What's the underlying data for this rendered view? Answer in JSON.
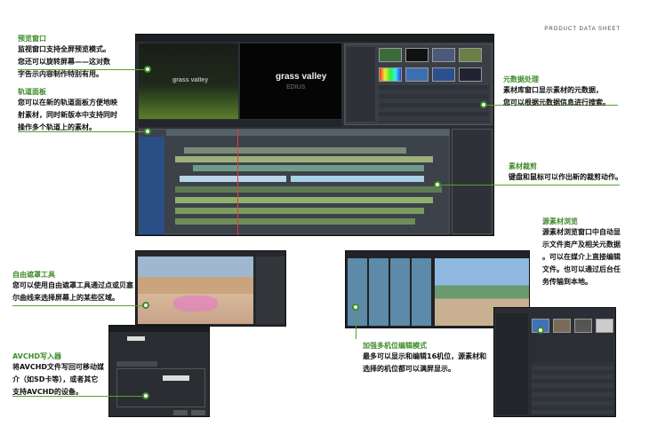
{
  "header": {
    "label": "PRODUCT DATA SHEET"
  },
  "sections": {
    "preview": {
      "title": "预览窗口",
      "lines": [
        "监视窗口支持全屏预览模式。",
        "您还可以旋转屏幕——这对数",
        "字告示内容制作特别有用。"
      ]
    },
    "track": {
      "title": "轨道面板",
      "lines": [
        "您可以在新的轨道面板方便地映",
        "射素材，同时新版本中支持同时",
        "操作多个轨道上的素材。"
      ]
    },
    "metadata": {
      "title": "元数据处理",
      "lines": [
        "素材库窗口显示素材的元数据，",
        "您可以根据元数据信息进行搜索。"
      ]
    },
    "trim": {
      "title": "素材裁剪",
      "lines": [
        "键盘和鼠标可以作出新的裁剪动作。"
      ]
    },
    "browser": {
      "title": "源素材浏览",
      "lines": [
        "源素材浏览窗口中自动显",
        "示文件资产及相关元数据",
        "。可以在媒介上直接编辑",
        "文件。也可以通过后台任",
        "务传输到本地。"
      ]
    },
    "mask": {
      "title": "自由遮罩工具",
      "lines": [
        "您可以使用自由遮罩工具通过点或贝塞",
        "尔曲线来选择屏幕上的某些区域。"
      ]
    },
    "avchd": {
      "title": "AVCHD写入器",
      "lines": [
        "将AVCHD文件写回可移动媒",
        "介（如SD卡等），或者其它",
        "支持AVCHD的设备。"
      ]
    },
    "multicam": {
      "title": "加强多机位编辑模式",
      "lines": [
        "最多可以显示和编辑16机位，源素材和",
        "选择的机位都可以满屏显示。"
      ]
    }
  },
  "screens": {
    "main": {
      "logo_text": "grass valley",
      "logo_sub": "EDIUS"
    }
  },
  "colors": {
    "accent": "#3f8a2a",
    "ui_dark": "#2b2f35"
  }
}
